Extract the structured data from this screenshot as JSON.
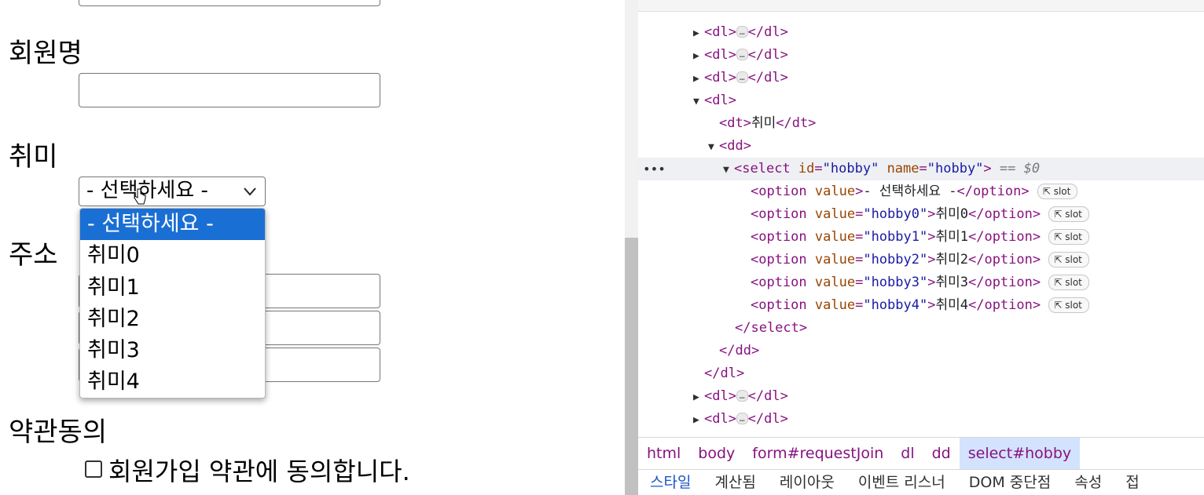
{
  "form": {
    "member_name_label": "회원명",
    "hobby_label": "취미",
    "address_label": "주소",
    "terms_label": "약관동의",
    "terms_checkbox_text": "회원가입 약관에 동의합니다.",
    "select_value": "- 선택하세요 -",
    "options": [
      "- 선택하세요 -",
      "취미0",
      "취미1",
      "취미2",
      "취미3",
      "취미4"
    ]
  },
  "devtools": {
    "dl": "dl",
    "dt_line": {
      "tag_open": "<dt>",
      "text": "취미",
      "tag_close": "</dt>"
    },
    "dd_open": "<dd>",
    "dd_close": "</dd>",
    "dl_close": "</dl>",
    "select": {
      "tag": "select",
      "id_name": "id",
      "id_value": "\"hobby\"",
      "name_name": "name",
      "name_value": "\"hobby\"",
      "eq": "== $0",
      "close": "</select>"
    },
    "options": [
      {
        "value": "",
        "text": "- 선택하세요 -"
      },
      {
        "value": "\"hobby0\"",
        "text": "취미0"
      },
      {
        "value": "\"hobby1\"",
        "text": "취미1"
      },
      {
        "value": "\"hobby2\"",
        "text": "취미2"
      },
      {
        "value": "\"hobby3\"",
        "text": "취미3"
      },
      {
        "value": "\"hobby4\"",
        "text": "취미4"
      }
    ],
    "slot_label": "slot",
    "ellipsis": "…",
    "breadcrumbs": [
      "html",
      "body",
      "form#requestJoin",
      "dl",
      "dd",
      "select#hobby"
    ],
    "tabs": [
      "스타일",
      "계산됨",
      "레이아웃",
      "이벤트 리스너",
      "DOM 중단점",
      "속성",
      "접"
    ]
  }
}
